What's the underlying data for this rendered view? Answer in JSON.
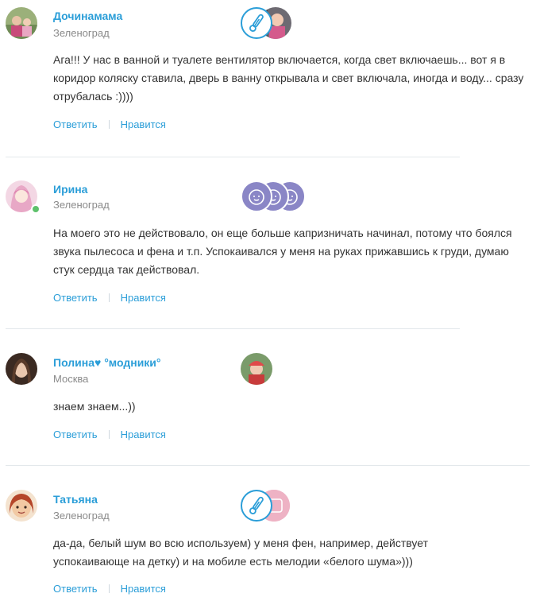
{
  "actions": {
    "reply": "Ответить",
    "like": "Нравится"
  },
  "comments": [
    {
      "name": "Дочинамама",
      "city": "Зеленоград",
      "text": "Ага!!! У нас в ванной и туалете вентилятор включается, когда свет включаешь... вот я в коридор коляску ставила, дверь в ванну открывала и свет включала, иногда и воду... сразу отрубалась :))))",
      "badges": [
        "thermometer-badge",
        "child-photo-badge"
      ]
    },
    {
      "name": "Ирина",
      "city": "Зеленоград",
      "text": "На моего это не действовало, он еще больше капризничать начинал, потому что боялся звука пылесоса и фена и т.п. Успокаивался у меня на руках прижавшись к груди, думаю стук сердца так действовал.",
      "online": true,
      "badges": [
        "baby-face-badge",
        "baby-face-badge",
        "baby-face-badge"
      ]
    },
    {
      "name": "Полина♥ °модники°",
      "city": "Москва",
      "text": "знаем знаем...))",
      "badges": [
        "child-photo-badge"
      ]
    },
    {
      "name": "Татьяна",
      "city": "Зеленоград",
      "text": "да-да, белый шум во всю используем) у меня фен, например, действует успокаивающе на детку) и на мобиле есть мелодии «белого шума»)))",
      "badges": [
        "thermometer-badge",
        "pink-badge"
      ]
    }
  ]
}
